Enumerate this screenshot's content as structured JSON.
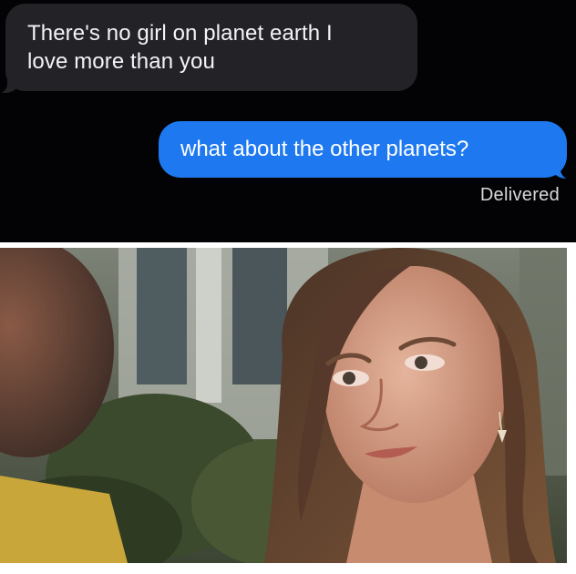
{
  "messages": {
    "received": {
      "line1": "There's no girl on planet earth I",
      "line2": "love more than you"
    },
    "sent": {
      "text": "what about the other planets?"
    },
    "status": "Delivered"
  },
  "colors": {
    "chat_background": "#030305",
    "received_bubble": "#232227",
    "sent_bubble": "#1e79f1",
    "status_text": "#d8d8dc"
  },
  "photo": {
    "subject": "woman-looking-sideways"
  }
}
